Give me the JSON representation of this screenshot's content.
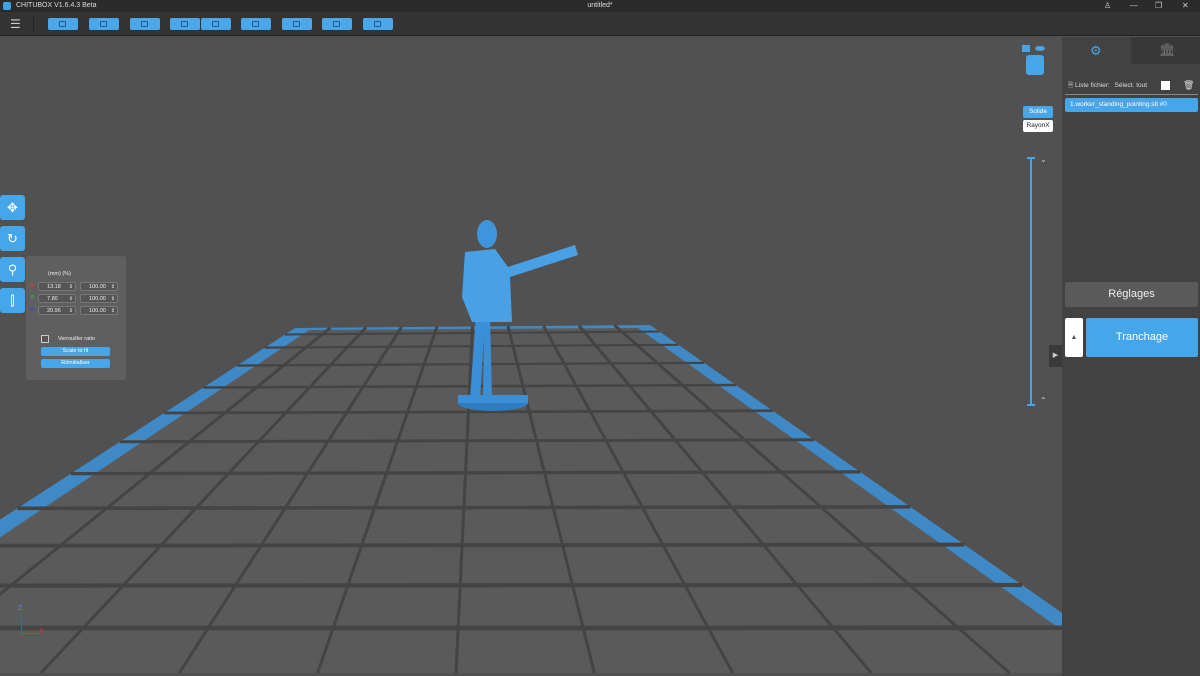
{
  "titlebar": {
    "app": "CHITUBOX V1.6.4.3 Beta",
    "document": "untitled*",
    "user": "♙",
    "minimize": "—",
    "restore": "❐",
    "close": "✕"
  },
  "toolbar": {
    "menu": "☰",
    "buttons": [
      "open",
      "save",
      "auto-layout",
      "import",
      "export",
      "dock",
      "hollow",
      "support",
      "drain-hole",
      "slice-preview"
    ]
  },
  "left_tools": [
    "move",
    "rotate",
    "scale",
    "mirror"
  ],
  "scale_panel": {
    "header": "(mm)  (%)",
    "rows": [
      {
        "axis": "X:",
        "mm": "13.18",
        "pct": "100.00",
        "color": "#e03030"
      },
      {
        "axis": "Y:",
        "mm": "7.80",
        "pct": "100.00",
        "color": "#30c030"
      },
      {
        "axis": "Z:",
        "mm": "20.96",
        "pct": "100.00",
        "color": "#3040e0"
      }
    ],
    "lock_ratio": "Verrouiller ratio",
    "scale_to_fit": "Scale to fit",
    "reset": "Réinitialiser"
  },
  "view_modes": {
    "solid": "Solide",
    "xray": "RayonX"
  },
  "right_panel": {
    "file_list_label": "Liste fichier:",
    "select_all": "Sélect. tout",
    "files": [
      "1.worker_standing_pointing.stl #0"
    ],
    "settings": "Réglages",
    "slice": "Tranchage",
    "slice_up": "▲",
    "expand": "▶"
  },
  "axes": {
    "x": "X",
    "z": "Z"
  },
  "colors": {
    "accent": "#45a6ea",
    "model": "#3b8fd6"
  }
}
